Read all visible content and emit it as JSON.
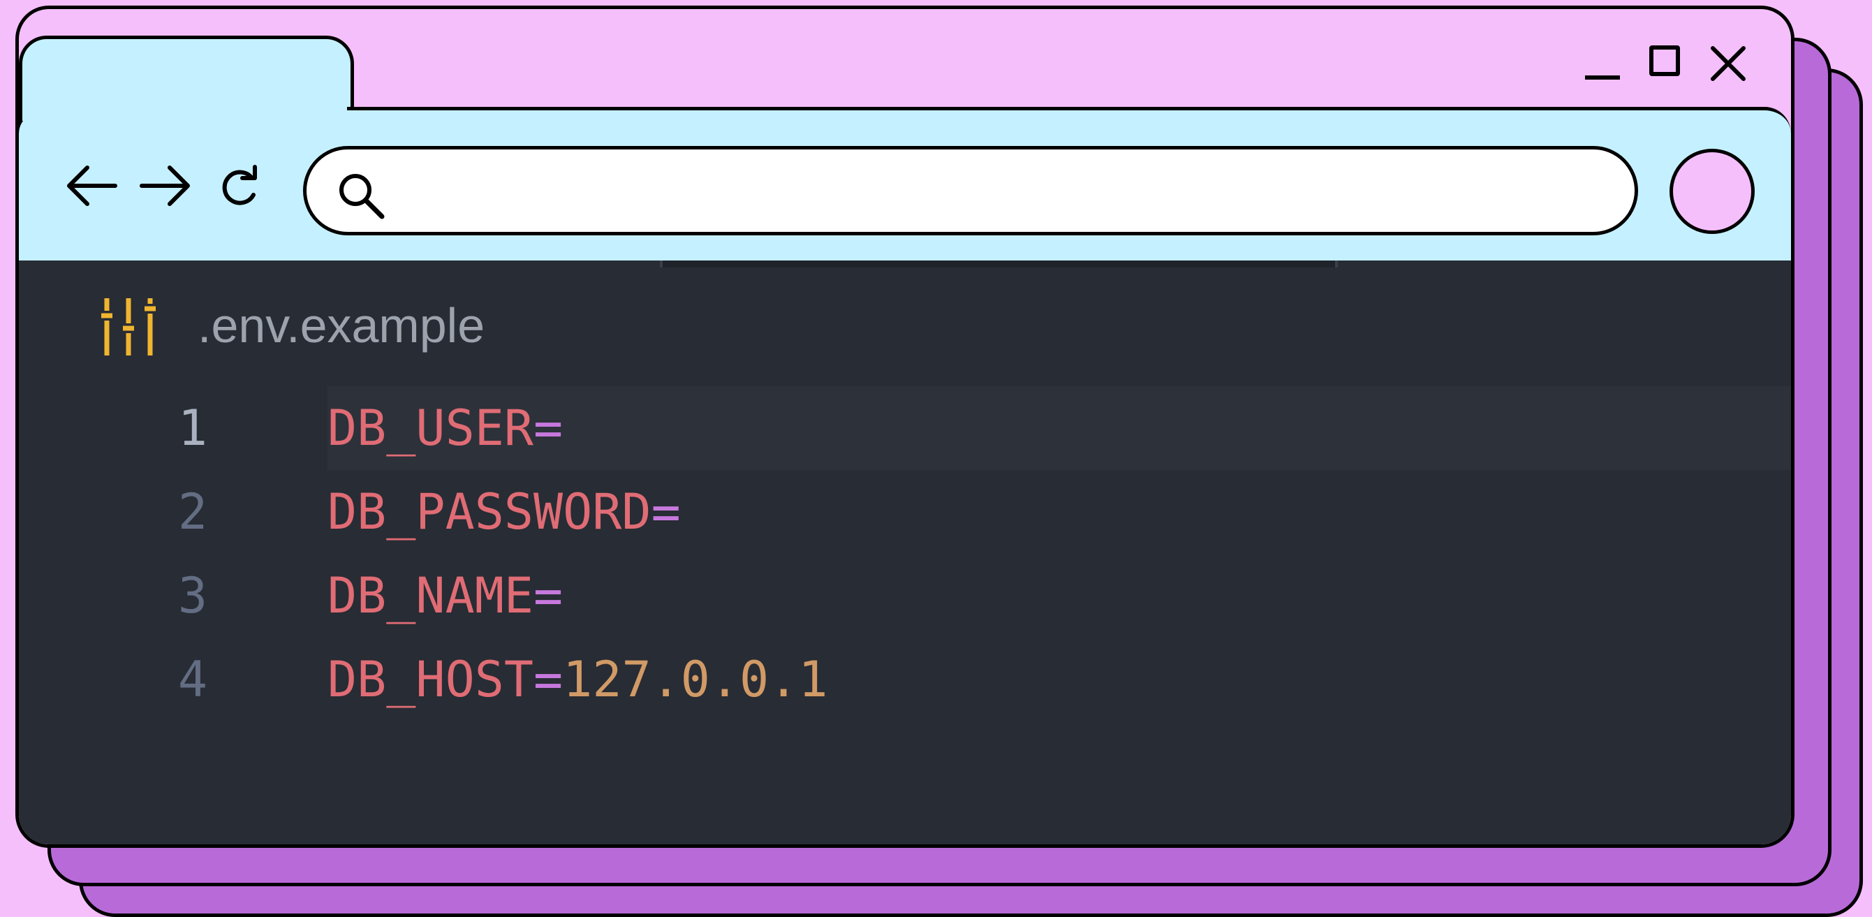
{
  "browser": {
    "address_placeholder": "",
    "colors": {
      "page_bg": "#f5bffb",
      "toolbar_bg": "#c5f0ff",
      "shadow_window": "#b96ad9"
    },
    "icons": [
      "minimize-icon",
      "maximize-icon",
      "close-icon",
      "back-arrow-icon",
      "forward-arrow-icon",
      "reload-icon",
      "search-icon",
      "avatar-circle"
    ]
  },
  "editor": {
    "file_name": ".env.example",
    "file_icon": "settings-sliders-icon",
    "lines": [
      {
        "number": "1",
        "key": "DB_USER",
        "eq": "=",
        "value": ""
      },
      {
        "number": "2",
        "key": "DB_PASSWORD",
        "eq": "=",
        "value": ""
      },
      {
        "number": "3",
        "key": "DB_NAME",
        "eq": "=",
        "value": ""
      },
      {
        "number": "4",
        "key": "DB_HOST",
        "eq": "=",
        "value": "127.0.0.1"
      }
    ],
    "colors": {
      "bg": "#282c34",
      "key": "#e06c75",
      "operator": "#c678dd",
      "value": "#d19a66",
      "line_number": "#636d83"
    }
  }
}
